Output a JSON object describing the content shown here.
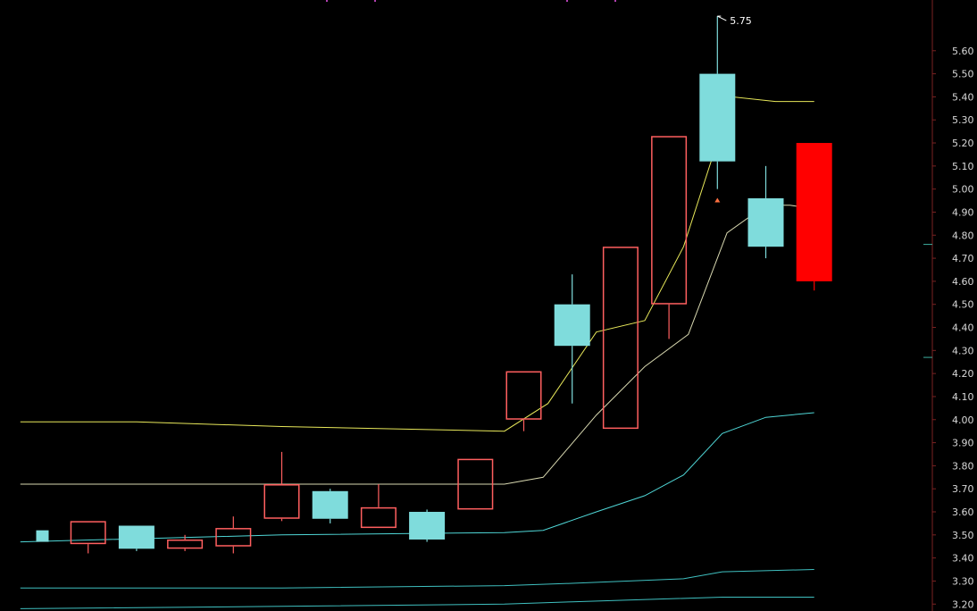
{
  "chart_data": {
    "type": "candlestick",
    "colors": {
      "background": "#000000",
      "up": "#ff5f5f",
      "down": "#7fdcdc",
      "up_filled": "#ff0000",
      "grid": "#7a2222",
      "axis_text": "#d8d8d8",
      "ma_short": "#e8e85a",
      "ma_mid": "#d8d8b0",
      "ma_long": "#4fd6d6",
      "ma_long2": "#3fc0c0",
      "marker": "#ff7040"
    },
    "y_axis": {
      "ylim": [
        3.17,
        5.82
      ],
      "ticks": [
        "3.20",
        "3.30",
        "3.40",
        "3.50",
        "3.60",
        "3.70",
        "3.80",
        "3.90",
        "4.00",
        "4.10",
        "4.20",
        "4.30",
        "4.40",
        "4.50",
        "4.60",
        "4.70",
        "4.80",
        "4.90",
        "5.00",
        "5.10",
        "5.20",
        "5.30",
        "5.40",
        "5.50",
        "5.60"
      ],
      "tick_values": [
        3.2,
        3.3,
        3.4,
        3.5,
        3.6,
        3.7,
        3.8,
        3.9,
        4.0,
        4.1,
        4.2,
        4.3,
        4.4,
        4.5,
        4.6,
        4.7,
        4.8,
        4.9,
        5.0,
        5.1,
        5.2,
        5.3,
        5.4,
        5.5,
        5.6
      ]
    },
    "candles": [
      {
        "x": 0,
        "open": 3.52,
        "high": 3.52,
        "low": 3.47,
        "close": 3.47
      },
      {
        "x": 1,
        "open": 3.46,
        "high": 3.56,
        "low": 3.42,
        "close": 3.56
      },
      {
        "x": 2,
        "open": 3.54,
        "high": 3.54,
        "low": 3.43,
        "close": 3.44
      },
      {
        "x": 3,
        "open": 3.44,
        "high": 3.5,
        "low": 3.43,
        "close": 3.48
      },
      {
        "x": 4,
        "open": 3.45,
        "high": 3.58,
        "low": 3.42,
        "close": 3.53
      },
      {
        "x": 5,
        "open": 3.57,
        "high": 3.86,
        "low": 3.56,
        "close": 3.72
      },
      {
        "x": 6,
        "open": 3.69,
        "high": 3.7,
        "low": 3.55,
        "close": 3.57
      },
      {
        "x": 7,
        "open": 3.53,
        "high": 3.72,
        "low": 3.53,
        "close": 3.62
      },
      {
        "x": 8,
        "open": 3.6,
        "high": 3.61,
        "low": 3.47,
        "close": 3.48
      },
      {
        "x": 9,
        "open": 3.61,
        "high": 3.83,
        "low": 3.61,
        "close": 3.83
      },
      {
        "x": 10,
        "open": 4.0,
        "high": 4.21,
        "low": 3.95,
        "close": 4.21
      },
      {
        "x": 11,
        "open": 4.5,
        "high": 4.63,
        "low": 4.07,
        "close": 4.32
      },
      {
        "x": 12,
        "open": 3.96,
        "high": 4.75,
        "low": 3.96,
        "close": 4.75
      },
      {
        "x": 13,
        "open": 4.5,
        "high": 5.23,
        "low": 4.35,
        "close": 5.23
      },
      {
        "x": 14,
        "open": 5.5,
        "high": 5.75,
        "low": 5.0,
        "close": 5.12
      },
      {
        "x": 15,
        "open": 4.96,
        "high": 5.1,
        "low": 4.7,
        "close": 4.75
      },
      {
        "x": 16,
        "open": 4.6,
        "high": 5.2,
        "low": 4.56,
        "close": 5.2,
        "filled": true
      }
    ],
    "ma_lines": [
      {
        "key": "ma_short",
        "points": [
          [
            -0.4,
            3.99
          ],
          [
            2,
            3.99
          ],
          [
            5,
            3.97
          ],
          [
            9.6,
            3.95
          ],
          [
            10.5,
            4.07
          ],
          [
            11.5,
            4.38
          ],
          [
            12.5,
            4.43
          ],
          [
            13.3,
            4.75
          ],
          [
            14.3,
            5.4
          ],
          [
            15.2,
            5.38
          ],
          [
            16,
            5.38
          ]
        ]
      },
      {
        "key": "ma_mid",
        "points": [
          [
            -0.4,
            3.72
          ],
          [
            5,
            3.72
          ],
          [
            9.6,
            3.72
          ],
          [
            10.4,
            3.75
          ],
          [
            11.5,
            4.02
          ],
          [
            12.5,
            4.23
          ],
          [
            13.4,
            4.37
          ],
          [
            14.2,
            4.81
          ],
          [
            15.0,
            4.93
          ],
          [
            15.5,
            4.93
          ],
          [
            15.8,
            4.92
          ]
        ]
      },
      {
        "key": "ma_long",
        "points": [
          [
            -0.4,
            3.47
          ],
          [
            5,
            3.5
          ],
          [
            9.6,
            3.51
          ],
          [
            10.4,
            3.52
          ],
          [
            11.5,
            3.6
          ],
          [
            12.5,
            3.67
          ],
          [
            13.3,
            3.76
          ],
          [
            14.1,
            3.94
          ],
          [
            15.0,
            4.01
          ],
          [
            16,
            4.03
          ]
        ]
      },
      {
        "key": "ma_long2",
        "points": [
          [
            -0.4,
            3.27
          ],
          [
            2,
            3.27
          ],
          [
            5,
            3.27
          ],
          [
            9.6,
            3.28
          ],
          [
            11,
            3.29
          ],
          [
            13.3,
            3.31
          ],
          [
            14.1,
            3.34
          ],
          [
            16,
            3.35
          ]
        ]
      },
      {
        "key": "ma_long2",
        "points": [
          [
            -0.4,
            3.18
          ],
          [
            5,
            3.19
          ],
          [
            9.6,
            3.2
          ],
          [
            11,
            3.21
          ],
          [
            14.1,
            3.23
          ],
          [
            16,
            3.23
          ]
        ]
      }
    ],
    "annotations": [
      {
        "text": "5.75",
        "x": 14,
        "y": 5.75
      }
    ],
    "markers": [
      {
        "x": 14,
        "y": 4.95,
        "shape": "triangle-up"
      }
    ],
    "right_ticks": [
      4.76,
      4.27
    ]
  }
}
